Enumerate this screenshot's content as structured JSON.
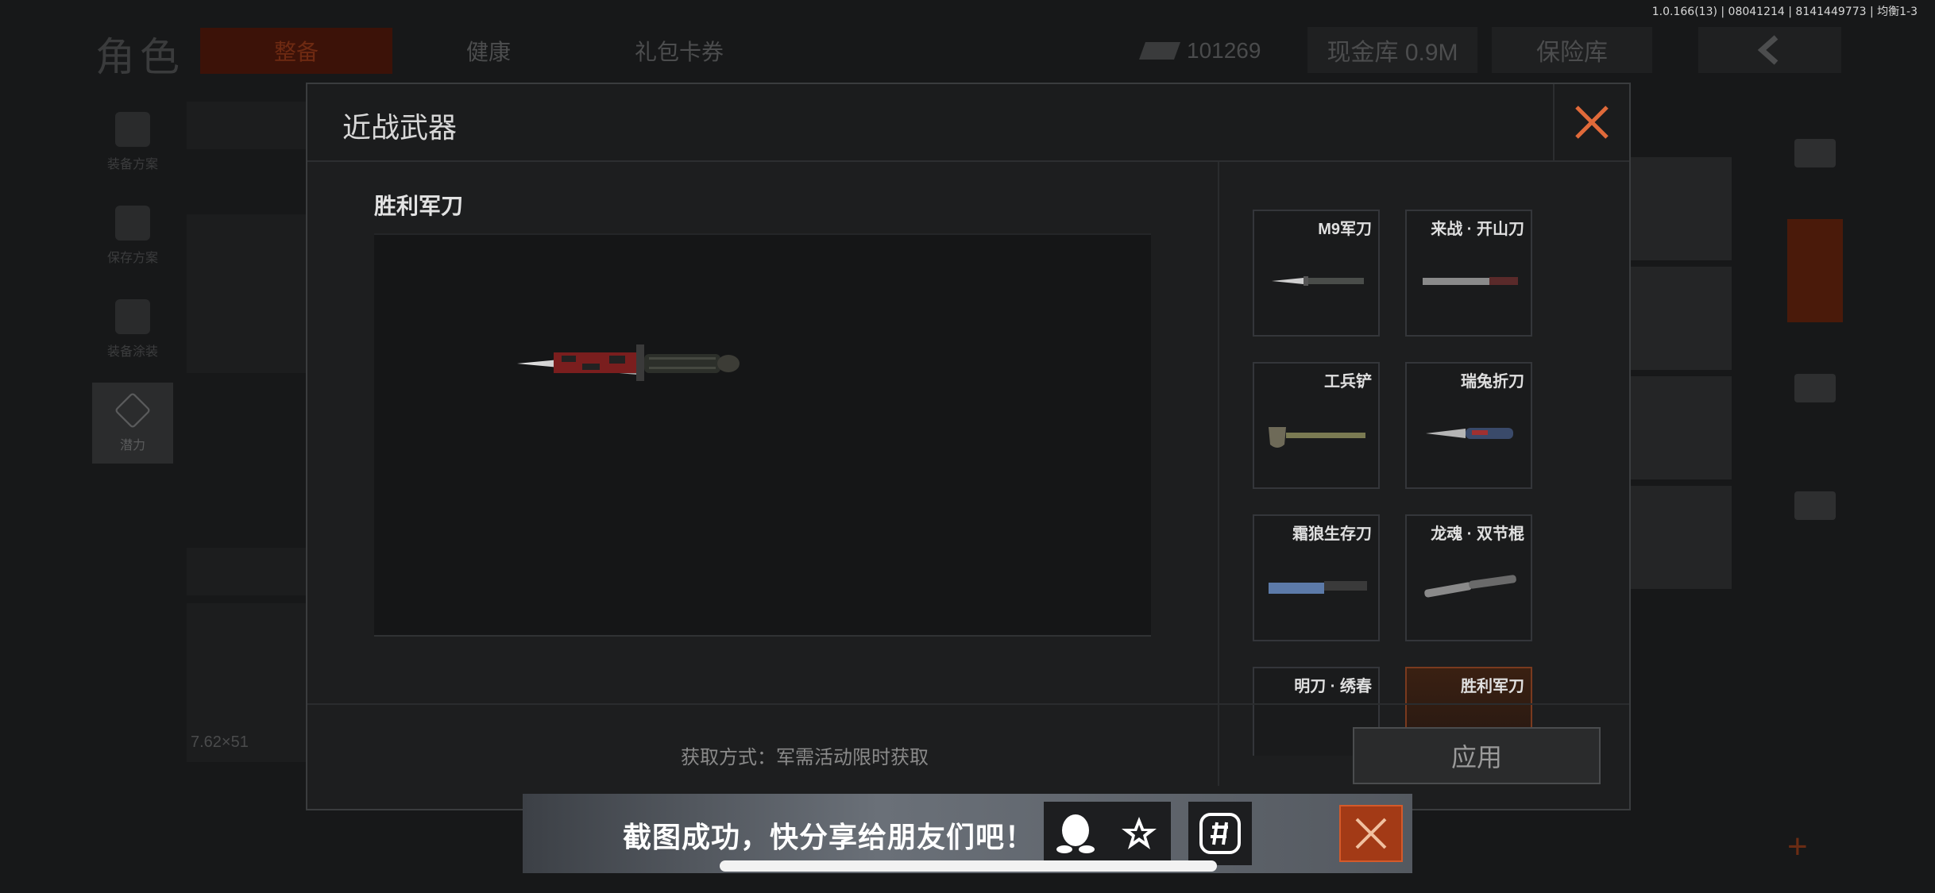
{
  "version": "1.0.166(13) | 08041214 | 8141449773 | 均衡1-3",
  "background": {
    "title": "角色",
    "tabs": [
      "整备",
      "健康",
      "礼包卡券"
    ],
    "currency_amount": "101269",
    "cash_bank": "现金库 0.9M",
    "safe_box": "保险库",
    "left_nav": [
      "装备方案",
      "保存方案",
      "装备涂装",
      "潜力"
    ],
    "caliber": "7.62×51"
  },
  "modal": {
    "title": "近战武器",
    "preview_name": "胜利军刀",
    "items": [
      {
        "label": "M9军刀",
        "icon": "bayonet-icon",
        "selected": false
      },
      {
        "label": "来战 · 开山刀",
        "icon": "machete-icon",
        "selected": false
      },
      {
        "label": "工兵铲",
        "icon": "shovel-icon",
        "selected": false
      },
      {
        "label": "瑞兔折刀",
        "icon": "folding-knife-icon",
        "selected": false
      },
      {
        "label": "霜狼生存刀",
        "icon": "survival-knife-icon",
        "selected": false
      },
      {
        "label": "龙魂 · 双节棍",
        "icon": "nunchaku-icon",
        "selected": false
      },
      {
        "label": "明刀 · 绣春",
        "icon": "sword-icon",
        "selected": false
      },
      {
        "label": "胜利军刀",
        "icon": "victory-knife-icon",
        "selected": true
      }
    ],
    "acquire_text": "获取方式：军需活动限时获取",
    "apply_label": "应用"
  },
  "toast": {
    "text": "截图成功，快分享给朋友们吧！",
    "accent": "#a33a16"
  }
}
